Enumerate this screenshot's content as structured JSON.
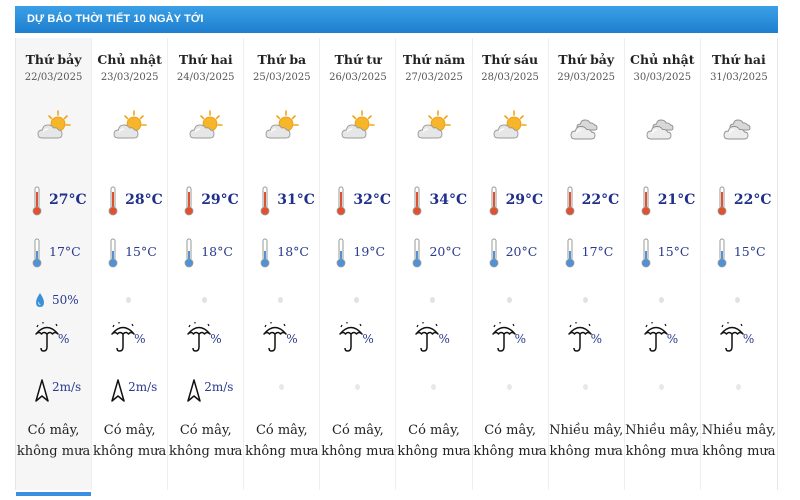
{
  "header": {
    "title": "DỰ BÁO THỜI TIẾT 10 NGÀY TỚI"
  },
  "days": [
    {
      "day": "Thứ bảy",
      "date": "22/03/2025",
      "icon": "partly-cloudy-sun",
      "max": "27°C",
      "min": "17°C",
      "rain": "50%",
      "rain_drop": true,
      "umbrella": "%",
      "wind": "2m/s",
      "desc1": "Có mây,",
      "desc2": "không mưa",
      "today": true
    },
    {
      "day": "Chủ nhật",
      "date": "23/03/2025",
      "icon": "partly-cloudy-sun",
      "max": "28°C",
      "min": "15°C",
      "rain": "",
      "rain_drop": false,
      "umbrella": "%",
      "wind": "2m/s",
      "desc1": "Có mây,",
      "desc2": "không mưa",
      "today": false
    },
    {
      "day": "Thứ hai",
      "date": "24/03/2025",
      "icon": "partly-cloudy-sun",
      "max": "29°C",
      "min": "18°C",
      "rain": "",
      "rain_drop": false,
      "umbrella": "%",
      "wind": "2m/s",
      "desc1": "Có mây,",
      "desc2": "không mưa",
      "today": false
    },
    {
      "day": "Thứ ba",
      "date": "25/03/2025",
      "icon": "partly-cloudy-sun",
      "max": "31°C",
      "min": "18°C",
      "rain": "",
      "rain_drop": false,
      "umbrella": "%",
      "wind": "",
      "desc1": "Có mây,",
      "desc2": "không mưa",
      "today": false
    },
    {
      "day": "Thứ tư",
      "date": "26/03/2025",
      "icon": "partly-cloudy-sun",
      "max": "32°C",
      "min": "19°C",
      "rain": "",
      "rain_drop": false,
      "umbrella": "%",
      "wind": "",
      "desc1": "Có mây,",
      "desc2": "không mưa",
      "today": false
    },
    {
      "day": "Thứ năm",
      "date": "27/03/2025",
      "icon": "partly-cloudy-sun",
      "max": "34°C",
      "min": "20°C",
      "rain": "",
      "rain_drop": false,
      "umbrella": "%",
      "wind": "",
      "desc1": "Có mây,",
      "desc2": "không mưa",
      "today": false
    },
    {
      "day": "Thứ sáu",
      "date": "28/03/2025",
      "icon": "partly-cloudy-sun",
      "max": "29°C",
      "min": "20°C",
      "rain": "",
      "rain_drop": false,
      "umbrella": "%",
      "wind": "",
      "desc1": "Có mây,",
      "desc2": "không mưa",
      "today": false
    },
    {
      "day": "Thứ bảy",
      "date": "29/03/2025",
      "icon": "cloudy",
      "max": "22°C",
      "min": "17°C",
      "rain": "",
      "rain_drop": false,
      "umbrella": "%",
      "wind": "",
      "desc1": "Nhiều mây,",
      "desc2": "không mưa",
      "today": false
    },
    {
      "day": "Chủ nhật",
      "date": "30/03/2025",
      "icon": "cloudy",
      "max": "21°C",
      "min": "15°C",
      "rain": "",
      "rain_drop": false,
      "umbrella": "%",
      "wind": "",
      "desc1": "Nhiều mây,",
      "desc2": "không mưa",
      "today": false
    },
    {
      "day": "Thứ hai",
      "date": "31/03/2025",
      "icon": "cloudy",
      "max": "22°C",
      "min": "15°C",
      "rain": "",
      "rain_drop": false,
      "umbrella": "%",
      "wind": "",
      "desc1": "Nhiều mây,",
      "desc2": "không mưa",
      "today": false
    }
  ],
  "colors": {
    "header": "#1e7fcf",
    "temp": "#1f2f8a",
    "thermo_max": "#e0522d",
    "thermo_min": "#4f92d6"
  }
}
